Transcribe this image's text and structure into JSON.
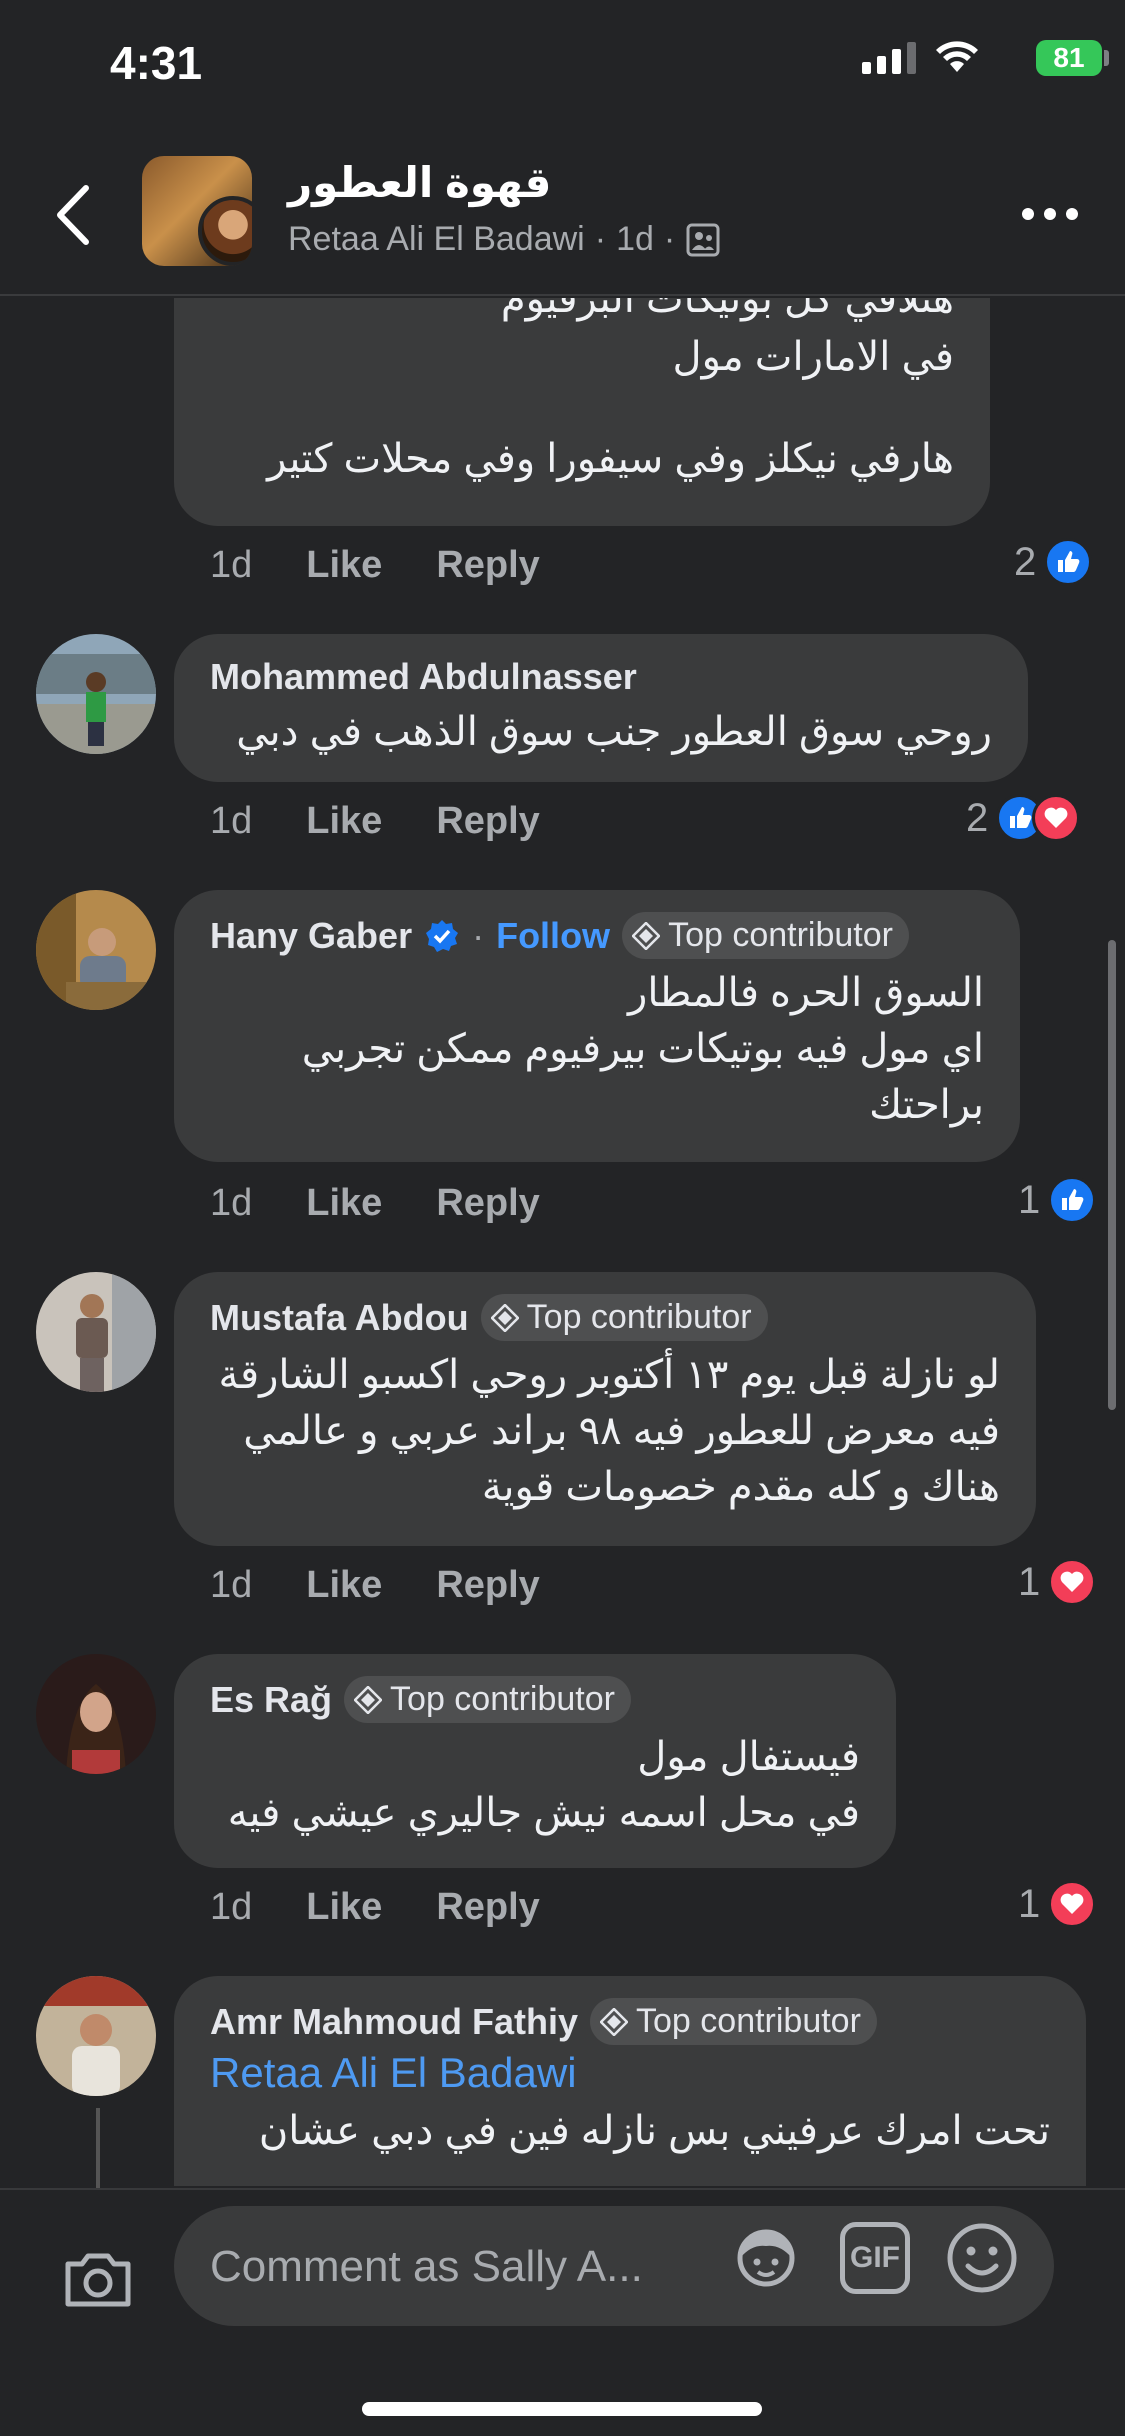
{
  "status_bar": {
    "time": "4:31",
    "battery": "81"
  },
  "header": {
    "group_name": "قهوة العطور",
    "author": "Retaa Ali El Badawi",
    "age": "1d",
    "separator": "·"
  },
  "comments": [
    {
      "text_lines": [
        "هتلاقي كل بوتيكات البرفيوم",
        "في الامارات مول",
        "",
        "هارفي نيكلز وفي سيفورا وفي محلات كتير"
      ],
      "age": "1d",
      "like_label": "Like",
      "reply_label": "Reply",
      "reaction_count": "2",
      "reactions": [
        "like"
      ]
    },
    {
      "name": "Mohammed Abdulnasser",
      "text_lines": [
        "روحي سوق العطور جنب سوق الذهب في دبي"
      ],
      "age": "1d",
      "like_label": "Like",
      "reply_label": "Reply",
      "reaction_count": "2",
      "reactions": [
        "like",
        "love"
      ]
    },
    {
      "name": "Hany Gaber",
      "verified": true,
      "follow_label": "Follow",
      "badge": "Top contributor",
      "text_lines": [
        "السوق الحره فالمطار",
        "اي مول فيه بوتيكات بيرفيوم ممكن تجربي",
        "براحتك"
      ],
      "age": "1d",
      "like_label": "Like",
      "reply_label": "Reply",
      "reaction_count": "1",
      "reactions": [
        "like"
      ]
    },
    {
      "name": "Mustafa Abdou",
      "badge": "Top contributor",
      "text_lines": [
        "لو نازلة قبل يوم ١٣ أكتوبر روحي اكسبو الشارقة",
        "فيه معرض للعطور فيه ٩٨ براند عربي و عالمي",
        "هناك و كله مقدم خصومات قوية"
      ],
      "age": "1d",
      "like_label": "Like",
      "reply_label": "Reply",
      "reaction_count": "1",
      "reactions": [
        "love"
      ]
    },
    {
      "name": "Es Rağ",
      "badge": "Top contributor",
      "text_lines": [
        "فيستفال مول",
        "في محل اسمه نيش جاليري عيشي فيه"
      ],
      "age": "1d",
      "like_label": "Like",
      "reply_label": "Reply",
      "reaction_count": "1",
      "reactions": [
        "love"
      ]
    },
    {
      "name": "Amr Mahmoud Fathiy",
      "badge": "Top contributor",
      "mention": "Retaa Ali El Badawi",
      "text_lines": [
        "تحت امرك عرفيني بس نازله فين في دبي عشان"
      ]
    }
  ],
  "composer": {
    "placeholder": "Comment as Sally A...",
    "gif_label": "GIF"
  },
  "colors": {
    "background": "#232426",
    "bubble": "#3a3b3c",
    "link": "#4599ff",
    "like": "#1877f2",
    "love": "#f33e58"
  }
}
